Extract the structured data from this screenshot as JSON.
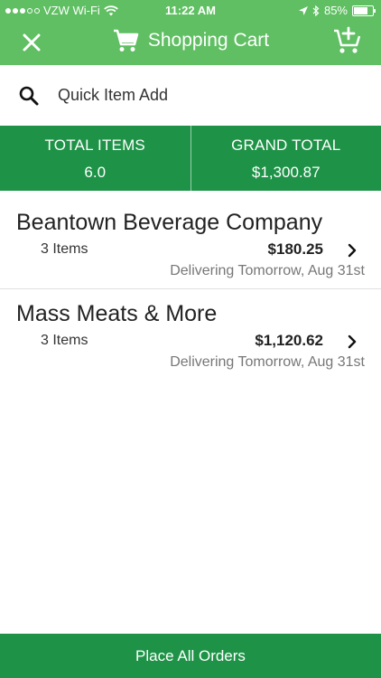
{
  "status_bar": {
    "carrier": "VZW Wi-Fi",
    "time": "11:22 AM",
    "battery": "85%",
    "battery_level": 0.85,
    "signal_bars": 3
  },
  "header": {
    "title": "Shopping Cart",
    "icons": [
      "close-icon",
      "cart-icon",
      "add-to-cart-icon"
    ],
    "background": "#5fbf62"
  },
  "search": {
    "placeholder": "Quick Item Add",
    "value": ""
  },
  "summary": {
    "total_items_label": "TOTAL ITEMS",
    "total_items_value": "6.0",
    "grand_total_label": "GRAND TOTAL",
    "grand_total_value": "$1,300.87",
    "background": "#1e9347"
  },
  "vendors": [
    {
      "name": "Beantown Beverage Company",
      "items": "3 Items",
      "total": "$180.25",
      "delivery": "Delivering Tomorrow, Aug 31st"
    },
    {
      "name": "Mass Meats & More",
      "items": "3 Items",
      "total": "$1,120.62",
      "delivery": "Delivering Tomorrow, Aug 31st"
    }
  ],
  "footer": {
    "place_orders_label": "Place All Orders"
  }
}
